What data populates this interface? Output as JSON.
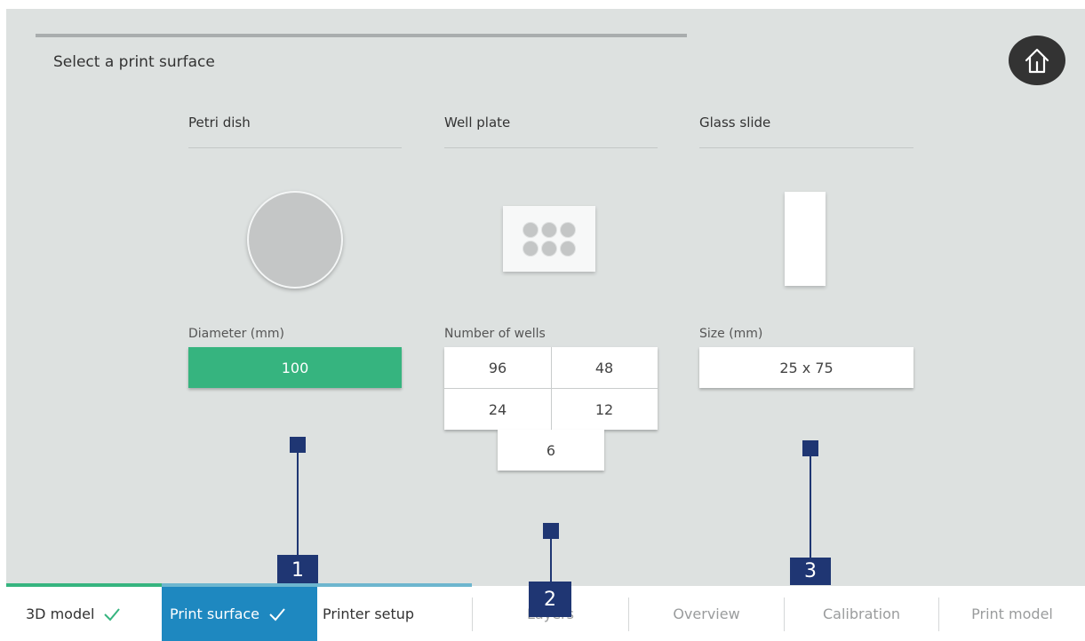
{
  "header": {
    "title": "Select a print surface"
  },
  "surfaces": {
    "petri": {
      "title": "Petri dish",
      "field_label": "Diameter (mm)",
      "value": "100"
    },
    "wellplate": {
      "title": "Well plate",
      "field_label": "Number of wells",
      "options": [
        "96",
        "48",
        "24",
        "12",
        "6"
      ]
    },
    "slide": {
      "title": "Glass slide",
      "field_label": "Size (mm)",
      "value": "25 x 75"
    }
  },
  "callouts": [
    "1",
    "2",
    "3"
  ],
  "nav": {
    "steps": [
      {
        "label": "3D model",
        "state": "done"
      },
      {
        "label": "Print surface",
        "state": "active"
      },
      {
        "label": "Printer setup",
        "state": "next"
      },
      {
        "label": "Layers",
        "state": "disabled"
      },
      {
        "label": "Overview",
        "state": "disabled"
      },
      {
        "label": "Calibration",
        "state": "disabled"
      },
      {
        "label": "Print model",
        "state": "disabled"
      }
    ]
  },
  "colors": {
    "accent_green": "#36b47f",
    "active_blue": "#1e88c0",
    "callout_navy": "#1f3673",
    "background": "#dde1e0"
  },
  "icons": {
    "home": "home-icon",
    "check": "check-icon"
  }
}
